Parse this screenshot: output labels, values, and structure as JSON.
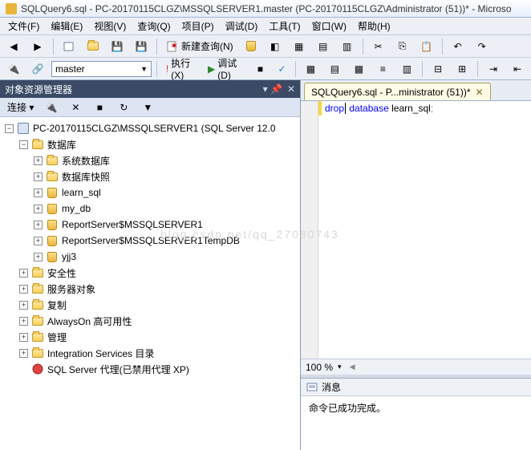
{
  "title": "SQLQuery6.sql - PC-20170115CLGZ\\MSSQLSERVER1.master (PC-20170115CLGZ\\Administrator (51))* - Microso",
  "menu": [
    "文件(F)",
    "编辑(E)",
    "视图(V)",
    "查询(Q)",
    "项目(P)",
    "调试(D)",
    "工具(T)",
    "窗口(W)",
    "帮助(H)"
  ],
  "toolbar1": {
    "new_query": "新建查询(N)"
  },
  "toolbar2": {
    "db": "master",
    "execute": "执行(X)",
    "debug": "调试(D)"
  },
  "explorer": {
    "title": "对象资源管理器",
    "connect": "连接 ▾",
    "root": "PC-20170115CLGZ\\MSSQLSERVER1 (SQL Server 12.0",
    "nodes": {
      "databases": "数据库",
      "sys_db": "系统数据库",
      "snapshot": "数据库快照",
      "db1": "learn_sql",
      "db2": "my_db",
      "db3": "ReportServer$MSSQLSERVER1",
      "db4": "ReportServer$MSSQLSERVER1TempDB",
      "db5": "yjj3",
      "security": "安全性",
      "server_obj": "服务器对象",
      "replication": "复制",
      "alwayson": "AlwaysOn 高可用性",
      "management": "管理",
      "is_catalog": "Integration Services 目录",
      "agent": "SQL Server 代理(已禁用代理 XP)"
    }
  },
  "editor": {
    "tab_label": "SQLQuery6.sql - P...ministrator (51))*",
    "code_kw1": "drop",
    "code_kw2": "database",
    "code_ident": "learn_sql",
    "zoom": "100 %"
  },
  "messages": {
    "tab": "消息",
    "text": "命令已成功完成。"
  },
  "watermark": "blog.csdn.net/qq_27080743"
}
